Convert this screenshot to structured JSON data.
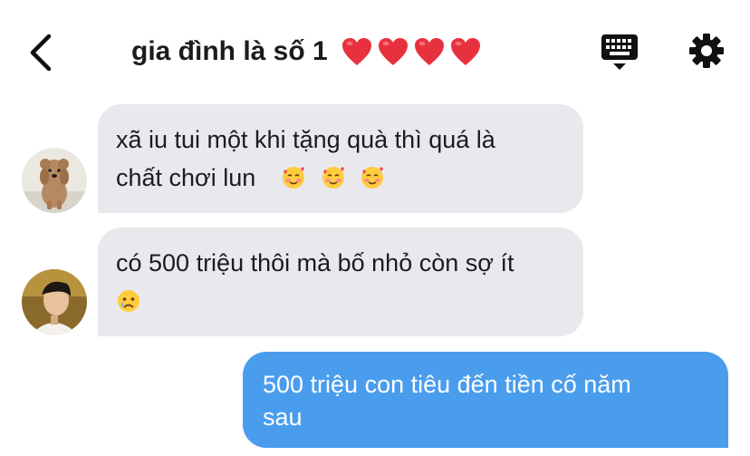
{
  "header": {
    "title": "gia đình là số 1",
    "hearts": [
      "heart-icon",
      "heart-icon",
      "heart-icon",
      "heart-icon"
    ],
    "colors": {
      "heart": "#e8313f",
      "icon": "#111111"
    }
  },
  "messages": [
    {
      "direction": "incoming",
      "avatar": "dog-avatar",
      "text": "xã iu tui một khi tặng quà thì quá là chất chơi lun",
      "emojis": [
        "smiling-face-with-hearts",
        "smiling-face-with-hearts",
        "smiling-face-with-hearts"
      ]
    },
    {
      "direction": "incoming",
      "avatar": "person-avatar",
      "text": "có 500 triệu thôi mà bố nhỏ còn sợ ít",
      "emojis": [
        "crying-face"
      ]
    },
    {
      "direction": "outgoing",
      "text": "500 triệu con tiêu đến tiền cố năm sau"
    }
  ],
  "colors": {
    "incoming_bubble": "#e9e9ed",
    "outgoing_bubble": "#4a9ded",
    "outgoing_text": "#ffffff"
  }
}
